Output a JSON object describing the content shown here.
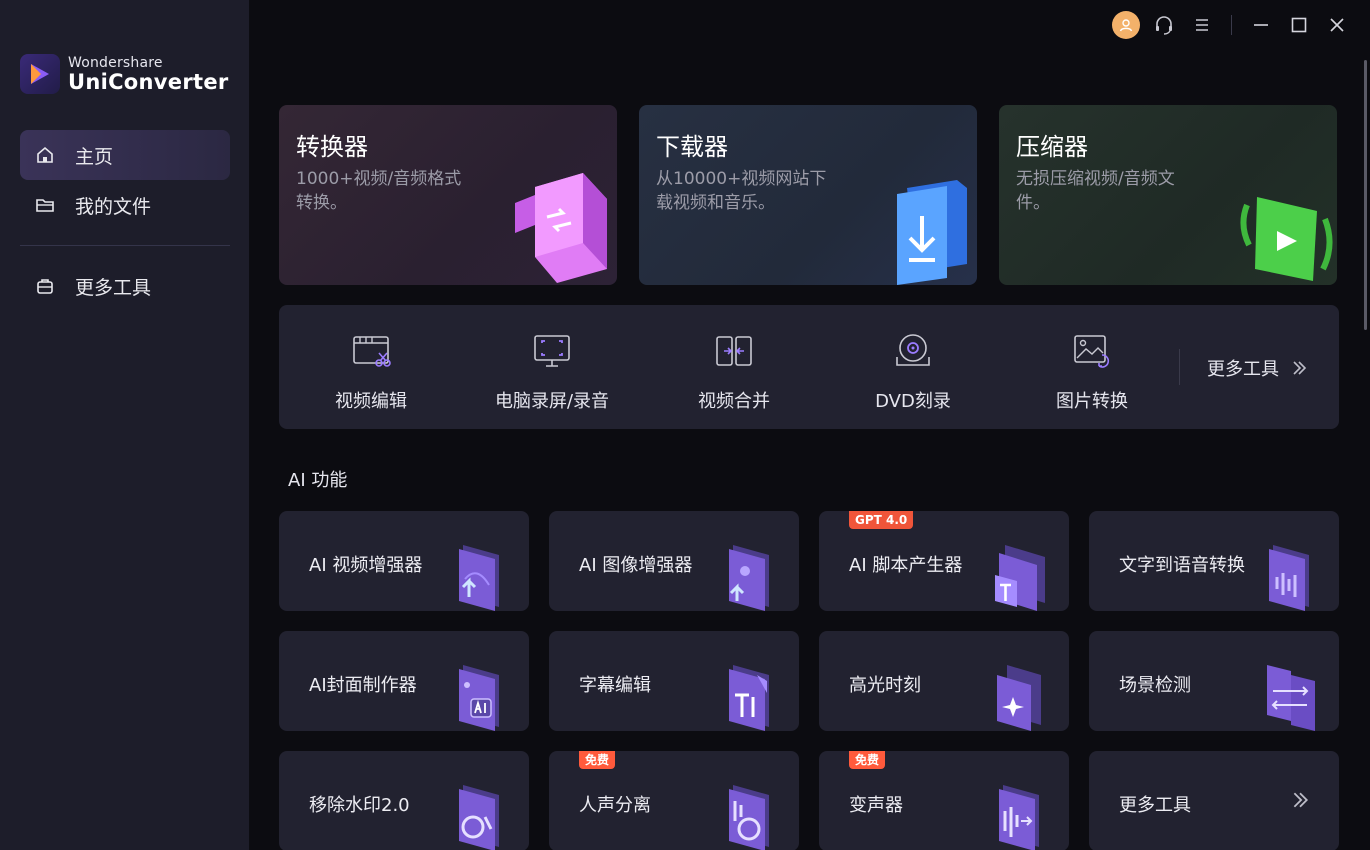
{
  "brand": {
    "company": "Wondershare",
    "product": "UniConverter"
  },
  "sidebar": {
    "items": [
      {
        "label": "主页",
        "icon": "home-icon",
        "active": true
      },
      {
        "label": "我的文件",
        "icon": "folder-icon",
        "active": false
      },
      {
        "label": "更多工具",
        "icon": "toolbox-icon",
        "active": false
      }
    ]
  },
  "titlebar": {
    "icons": [
      "user-avatar-icon",
      "support-headset-icon",
      "menu-icon",
      "minimize-icon",
      "maximize-icon",
      "close-icon"
    ]
  },
  "hero": [
    {
      "title": "转换器",
      "desc": "1000+视频/音频格式转换。",
      "icon": "converter-icon"
    },
    {
      "title": "下载器",
      "desc": "从10000+视频网站下载视频和音乐。",
      "icon": "downloader-icon"
    },
    {
      "title": "压缩器",
      "desc": "无损压缩视频/音频文件。",
      "icon": "compressor-icon"
    }
  ],
  "tools": {
    "items": [
      {
        "label": "视频编辑",
        "icon": "video-edit-icon"
      },
      {
        "label": "电脑录屏/录音",
        "icon": "screen-record-icon"
      },
      {
        "label": "视频合并",
        "icon": "video-merge-icon"
      },
      {
        "label": "DVD刻录",
        "icon": "dvd-burn-icon"
      },
      {
        "label": "图片转换",
        "icon": "image-convert-icon"
      }
    ],
    "more_label": "更多工具"
  },
  "ai": {
    "section_title": "AI 功能",
    "cards": [
      {
        "label": "AI 视频增强器",
        "badge": ""
      },
      {
        "label": "AI 图像增强器",
        "badge": ""
      },
      {
        "label": "AI 脚本产生器",
        "badge": "GPT 4.0"
      },
      {
        "label": "文字到语音转换",
        "badge": ""
      },
      {
        "label": "AI封面制作器",
        "badge": ""
      },
      {
        "label": "字幕编辑",
        "badge": ""
      },
      {
        "label": "高光时刻",
        "badge": ""
      },
      {
        "label": "场景检测",
        "badge": ""
      },
      {
        "label": "移除水印2.0",
        "badge": ""
      },
      {
        "label": "人声分离",
        "badge": "免费"
      },
      {
        "label": "变声器",
        "badge": "免费"
      },
      {
        "label": "更多工具",
        "badge": ""
      }
    ]
  },
  "colors": {
    "accent": "#7b5cf0",
    "badge": "#ff5a3c",
    "sidebar_bg": "#1d1d2a",
    "card_bg": "#222230"
  }
}
